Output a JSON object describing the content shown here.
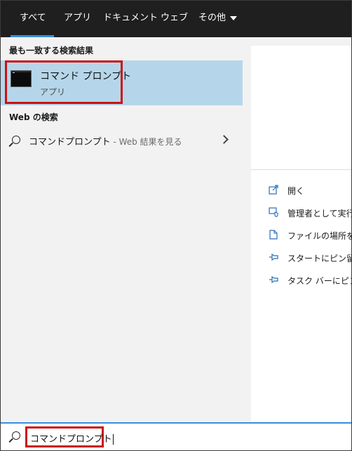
{
  "tabs": [
    {
      "label": "すべて",
      "active": true
    },
    {
      "label": "アプリ",
      "active": false
    },
    {
      "label": "ドキュメント",
      "active": false
    },
    {
      "label": "ウェブ",
      "active": false
    },
    {
      "label": "その他",
      "active": false
    }
  ],
  "best_match": {
    "section_label": "最も一致する検索結果",
    "title": "コマンド プロンプト",
    "subtitle": "アプリ",
    "icon": "command-prompt-icon"
  },
  "web_search": {
    "section_label": "Web の検索",
    "query": "コマンドプロンプト",
    "suffix": " - Web 結果を見る"
  },
  "actions": [
    {
      "label": "開く",
      "icon": "open-icon"
    },
    {
      "label": "管理者として実行",
      "icon": "run-as-admin-icon"
    },
    {
      "label": "ファイルの場所を開く",
      "icon": "file-location-icon"
    },
    {
      "label": "スタートにピン留めする",
      "icon": "pin-icon"
    },
    {
      "label": "タスク バーにピン留めする",
      "icon": "pin-icon"
    }
  ],
  "search_box": {
    "value": "コマンドプロンプト"
  },
  "colors": {
    "accent": "#3a8ddc",
    "highlight": "#cc1111",
    "selected": "#b5d6ea"
  }
}
